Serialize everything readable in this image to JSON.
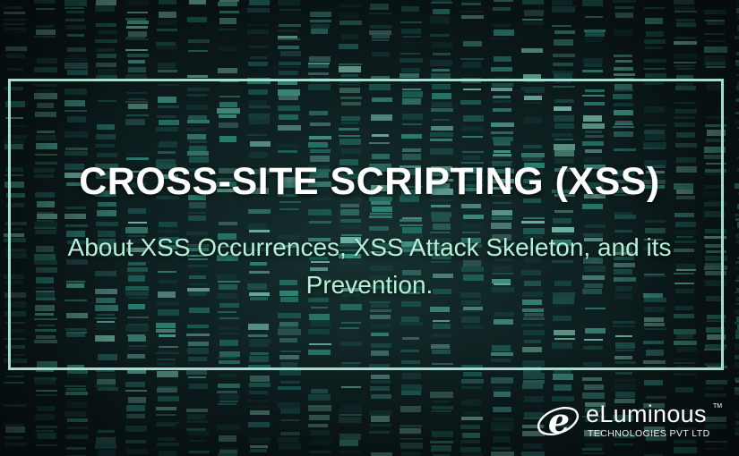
{
  "banner": {
    "title": "CROSS-SITE SCRIPTING (XSS)",
    "subtitle": "About XSS Occurrences, XSS Attack Skeleton, and its Prevention."
  },
  "logo": {
    "letter": "e",
    "name": "eLuminous",
    "trademark": "TM",
    "tagline": "TECHNOLOGIES PVT LTD"
  },
  "colors": {
    "frame": "#a3ddce",
    "title": "#ffffff",
    "subtitle": "#b4f0d8",
    "bar_teal": "#2f8f7f",
    "bar_light": "#7fc9b6",
    "background": "#0c1c1d"
  },
  "icons": {
    "logo_mark": "eluminous-logo-icon"
  }
}
